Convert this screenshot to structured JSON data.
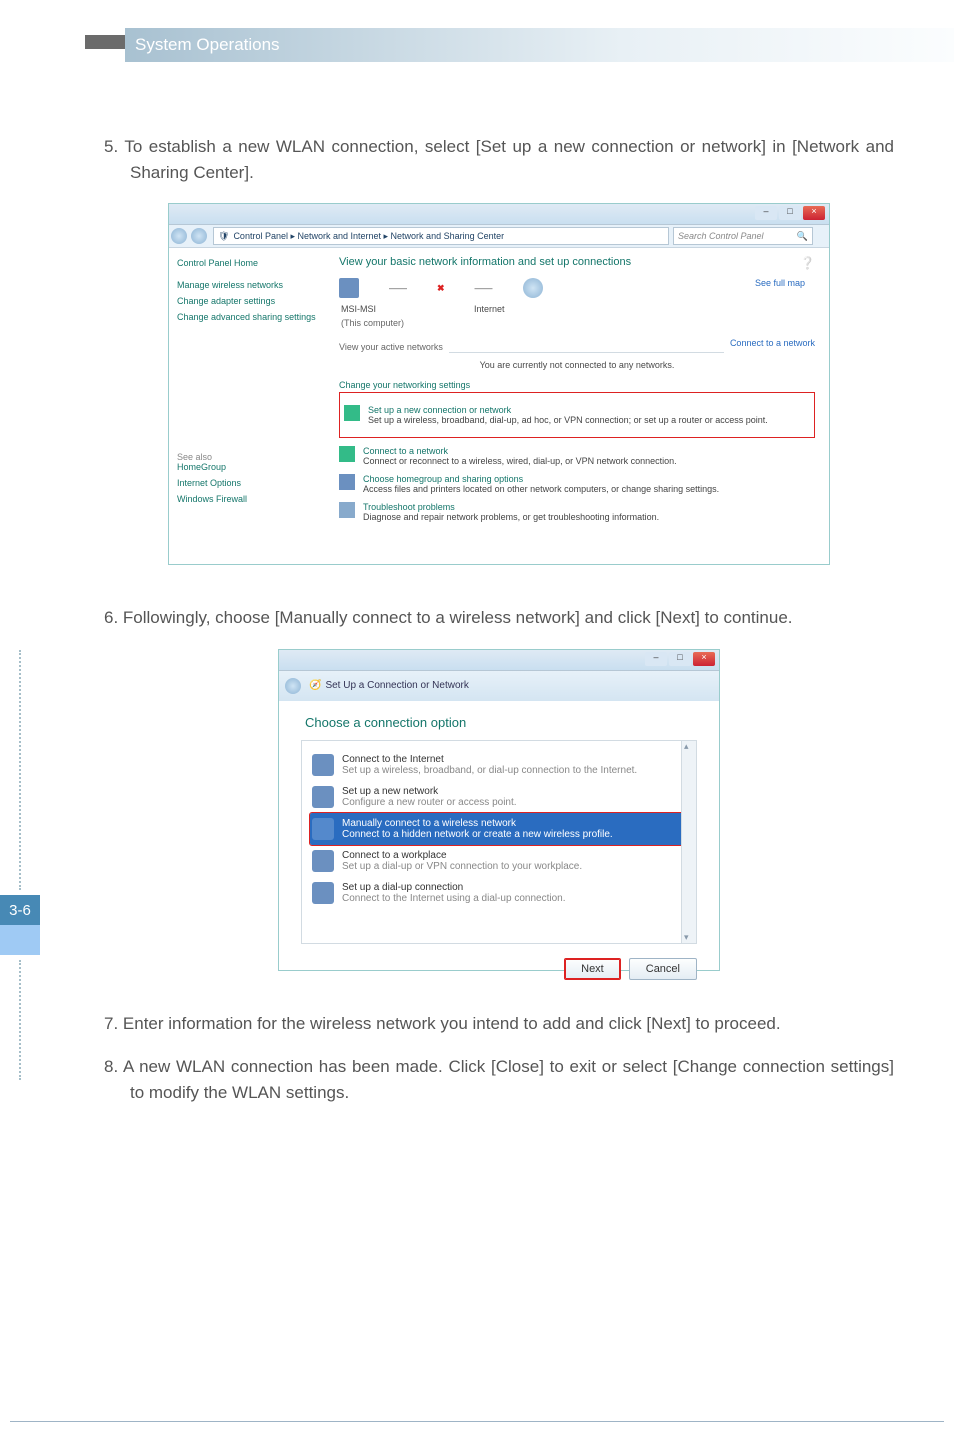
{
  "header": {
    "title": "System Operations"
  },
  "page_number": "3-6",
  "steps": {
    "s5": "5. To establish a new WLAN connection, select [Set up a new connection or network] in [Network and Sharing Center].",
    "s6": "6. Followingly, choose [Manually connect to a wireless network] and click [Next] to continue.",
    "s7": "7. Enter information for the wireless network you intend to add and click [Next] to proceed.",
    "s8": "8. A new WLAN connection has been made. Click [Close] to exit or select [Change connection settings] to modify the WLAN settings."
  },
  "fig1": {
    "breadcrumb_icon": "▸",
    "breadcrumb": "Control Panel  ▸  Network and Internet  ▸  Network and Sharing Center",
    "search_placeholder": "Search Control Panel",
    "sidebar": {
      "home": "Control Panel Home",
      "links": [
        "Manage wireless networks",
        "Change adapter settings",
        "Change advanced sharing settings"
      ],
      "see_also_h": "See also",
      "see_also": [
        "HomeGroup",
        "Internet Options",
        "Windows Firewall"
      ]
    },
    "main": {
      "title": "View your basic network information and set up connections",
      "see_full_map": "See full map",
      "node1": "MSI-MSI",
      "node1_sub": "(This computer)",
      "node2": "Internet",
      "active_h": "View your active networks",
      "active_msg": "You are currently not connected to any networks.",
      "connect_link": "Connect to a network",
      "change_h": "Change your networking settings",
      "opts": [
        {
          "t": "Set up a new connection or network",
          "d": "Set up a wireless, broadband, dial-up, ad hoc, or VPN connection; or set up a router or access point."
        },
        {
          "t": "Connect to a network",
          "d": "Connect or reconnect to a wireless, wired, dial-up, or VPN network connection."
        },
        {
          "t": "Choose homegroup and sharing options",
          "d": "Access files and printers located on other network computers, or change sharing settings."
        },
        {
          "t": "Troubleshoot problems",
          "d": "Diagnose and repair network problems, or get troubleshooting information."
        }
      ]
    }
  },
  "fig2": {
    "title_bar": "Set Up a Connection or Network",
    "heading": "Choose a connection option",
    "items": [
      {
        "t": "Connect to the Internet",
        "d": "Set up a wireless, broadband, or dial-up connection to the Internet."
      },
      {
        "t": "Set up a new network",
        "d": "Configure a new router or access point."
      },
      {
        "t": "Manually connect to a wireless network",
        "d": "Connect to a hidden network or create a new wireless profile."
      },
      {
        "t": "Connect to a workplace",
        "d": "Set up a dial-up or VPN connection to your workplace."
      },
      {
        "t": "Set up a dial-up connection",
        "d": "Connect to the Internet using a dial-up connection."
      }
    ],
    "next": "Next",
    "cancel": "Cancel"
  }
}
